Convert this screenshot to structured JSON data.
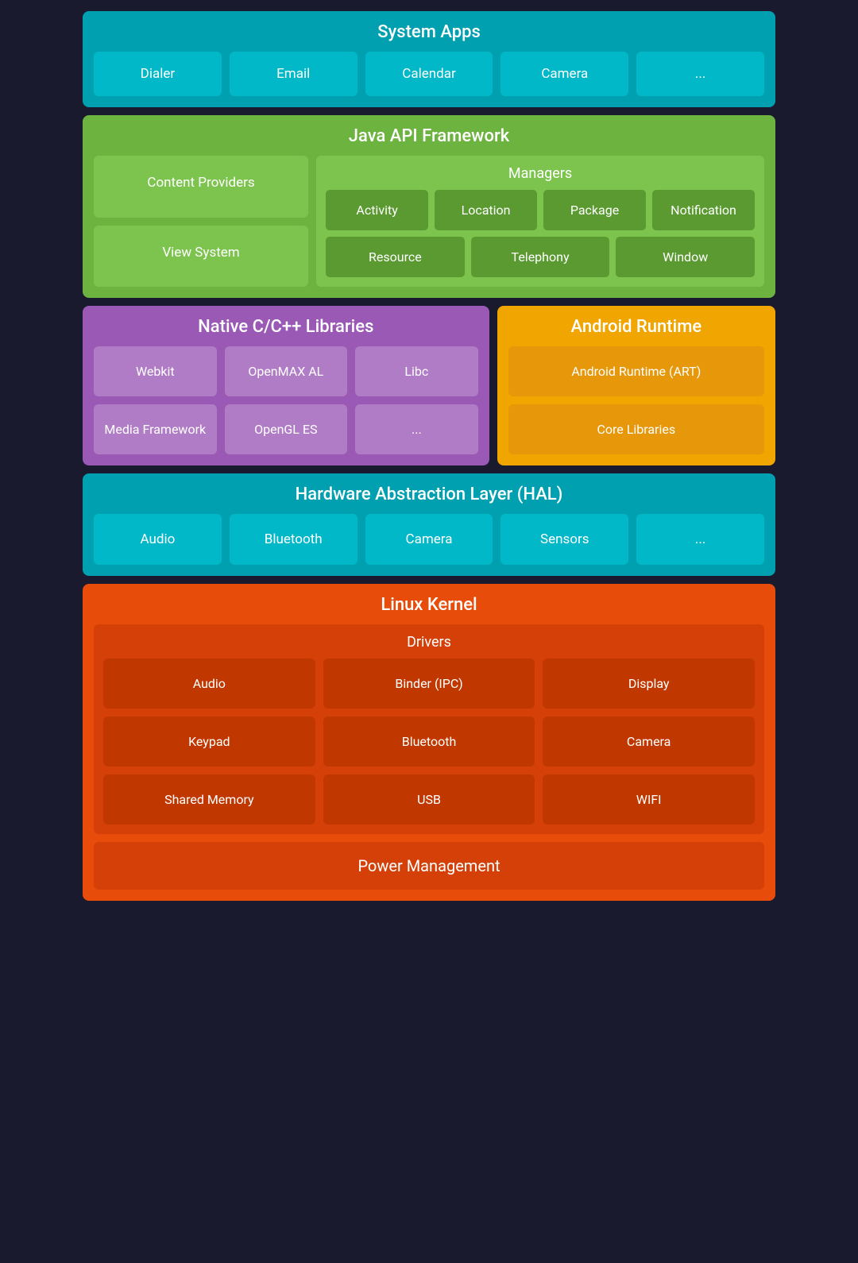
{
  "systemApps": {
    "title": "System Apps",
    "apps": [
      "Dialer",
      "Email",
      "Calendar",
      "Camera",
      "..."
    ]
  },
  "javaApi": {
    "title": "Java API Framework",
    "leftBoxes": [
      "Content Providers",
      "View System"
    ],
    "managers": {
      "title": "Managers",
      "row1": [
        "Activity",
        "Location",
        "Package",
        "Notification"
      ],
      "row2": [
        "Resource",
        "Telephony",
        "Window"
      ]
    }
  },
  "nativeLibs": {
    "title": "Native C/C++ Libraries",
    "items": [
      "Webkit",
      "OpenMAX AL",
      "Libc",
      "Media Framework",
      "OpenGL ES",
      "..."
    ]
  },
  "androidRuntime": {
    "title": "Android Runtime",
    "items": [
      "Android Runtime (ART)",
      "Core Libraries"
    ]
  },
  "hal": {
    "title": "Hardware Abstraction Layer (HAL)",
    "items": [
      "Audio",
      "Bluetooth",
      "Camera",
      "Sensors",
      "..."
    ]
  },
  "linuxKernel": {
    "title": "Linux Kernel",
    "drivers": {
      "title": "Drivers",
      "items": [
        "Audio",
        "Binder (IPC)",
        "Display",
        "Keypad",
        "Bluetooth",
        "Camera",
        "Shared Memory",
        "USB",
        "WIFI"
      ]
    },
    "powerManagement": "Power Management"
  }
}
